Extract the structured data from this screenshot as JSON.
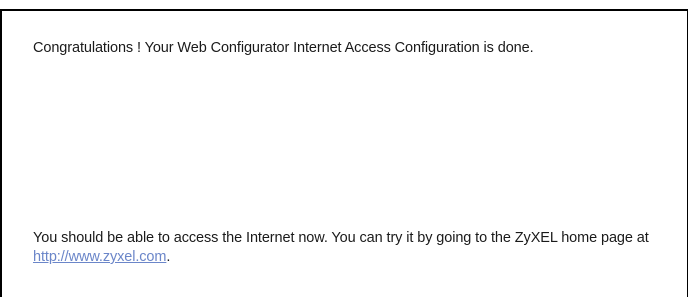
{
  "wizard": {
    "congrats_text": "Congratulations ! Your Web Configurator Internet Access Configuration is done.",
    "access_text_before": "You should be able to access the Internet now. You can try it by going to the ZyXEL home page at ",
    "home_link_text": "http://www.zyxel.com",
    "access_text_after": "."
  },
  "colors": {
    "link": "#6b86c9",
    "border": "#000000",
    "text": "#1a1a1a"
  }
}
